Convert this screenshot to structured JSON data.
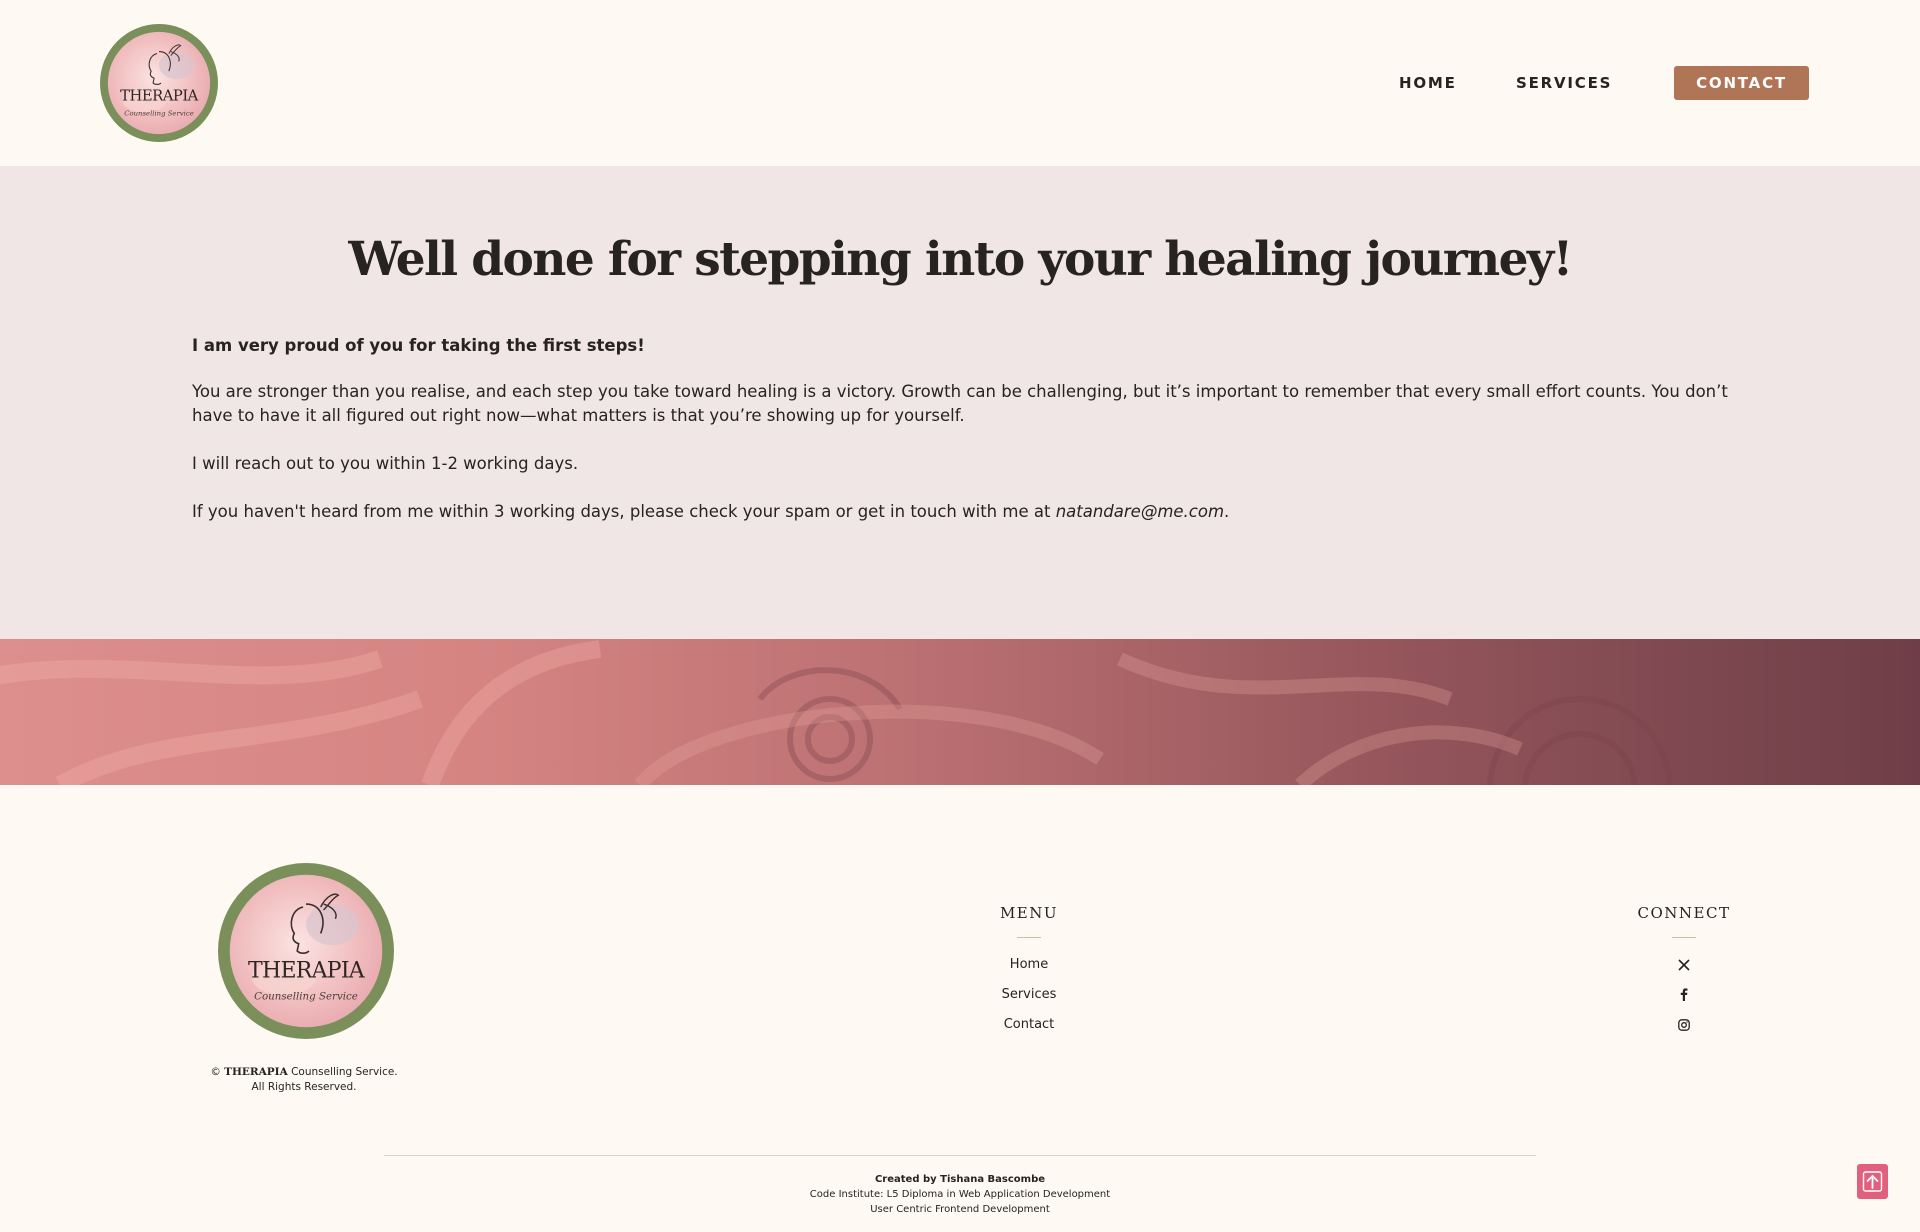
{
  "header": {
    "logo": {
      "brand": "THERAPIA",
      "tagline": "Counselling Service"
    },
    "nav": {
      "home": "HOME",
      "services": "SERVICES",
      "contact": "CONTACT"
    }
  },
  "main": {
    "headline": "Well done for stepping into your healing journey!",
    "lead": "I am very proud of you for taking the first steps!",
    "paragraph_1": "You are stronger than you realise, and each step you take toward healing is a victory. Growth can be challenging, but it’s important to remember that every small effort counts. You don’t have to have it all figured out right now—what matters is that you’re showing up for yourself.",
    "paragraph_2": "I will reach out to you within 1-2 working days.",
    "paragraph_3_prefix": "If you haven't heard from me within 3 working days, please check your spam or get in touch with me at ",
    "email": "natandare@me.com",
    "paragraph_3_suffix": "."
  },
  "footer": {
    "logo": {
      "brand": "THERAPIA",
      "tagline": "Counselling Service"
    },
    "copyright": {
      "symbol": "©",
      "brand": "THERAPIA",
      "line_1": "Counselling Service.",
      "line_2": "All Rights Reserved."
    },
    "menu": {
      "title": "MENU",
      "items": [
        "Home",
        "Services",
        "Contact"
      ]
    },
    "connect": {
      "title": "CONNECT",
      "icons": [
        "x-icon",
        "facebook-icon",
        "instagram-icon"
      ]
    },
    "credits": {
      "author": "Created by Tishana Bascombe",
      "line_2": "Code Institute: L5 Diploma in Web Application Development",
      "line_3": "User Centric Frontend Development"
    },
    "back_to_top_icon": "arrow-up-icon"
  },
  "colors": {
    "page_background": "#fef9f2",
    "section_background": "#f0e6e5",
    "accent": "#b07557",
    "logo_ring": "#7a8f5a",
    "back_to_top": "#e0607e"
  }
}
